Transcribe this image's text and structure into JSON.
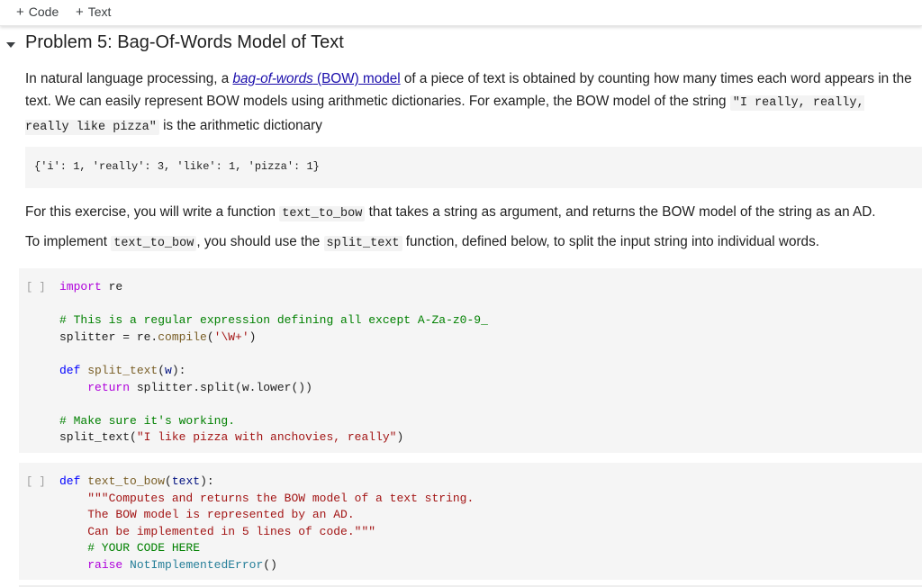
{
  "toolbar": {
    "add_code_label": "Code",
    "add_text_label": "Text",
    "plus_glyph": "+"
  },
  "section": {
    "title": "Problem 5: Bag-Of-Words Model of Text"
  },
  "intro": {
    "part1": "In natural language processing, a ",
    "link_italic": "bag-of-words",
    "link_rest": " (BOW) model",
    "part2": " of a piece of text is obtained by counting how many times each word appears in the text. We can easily represent BOW models using arithmetic dictionaries. For example, the BOW model of the string ",
    "code_example": "\"I really, really, really like pizza\"",
    "part3": " is the arithmetic dictionary"
  },
  "example_output": "{'i': 1, 'really': 3, 'like': 1, 'pizza': 1}",
  "exercise": {
    "p1_a": "For this exercise, you will write a function ",
    "p1_code": "text_to_bow",
    "p1_b": " that takes a string as argument, and returns the BOW model of the string as an AD.",
    "p2_a": "To implement ",
    "p2_code1": "text_to_bow",
    "p2_b": ", you should use the ",
    "p2_code2": "split_text",
    "p2_c": " function, defined below, to split the input string into individual words."
  },
  "cells": [
    {
      "run_bracket": "[ ]",
      "lines": {
        "l1_kw": "import",
        "l1_rest": " re",
        "l3_comment": "# This is a regular expression defining all except A-Za-z0-9_",
        "l4_a": "splitter = re.",
        "l4_fn": "compile",
        "l4_b": "(",
        "l4_str": "'\\W+'",
        "l4_c": ")",
        "l6_def": "def",
        "l6_fn": " split_text",
        "l6_a": "(",
        "l6_param": "w",
        "l6_b": "):",
        "l7_indent": "    ",
        "l7_kw": "return",
        "l7_rest": " splitter.split(w.lower())",
        "l9_comment": "# Make sure it's working.",
        "l10_a": "split_text(",
        "l10_str": "\"I like pizza with anchovies, really\"",
        "l10_b": ")"
      }
    },
    {
      "run_bracket": "[ ]",
      "lines": {
        "l1_def": "def",
        "l1_fn": " text_to_bow",
        "l1_a": "(",
        "l1_param": "text",
        "l1_b": "):",
        "l2": "    \"\"\"Computes and returns the BOW model of a text string.",
        "l3": "    The BOW model is represented by an AD.",
        "l4": "    Can be implemented in 5 lines of code.\"\"\"",
        "l5_comment": "    # YOUR CODE HERE",
        "l6_indent": "    ",
        "l6_kw": "raise",
        "l6_cls": " NotImplementedError",
        "l6_rest": "()"
      }
    }
  ]
}
